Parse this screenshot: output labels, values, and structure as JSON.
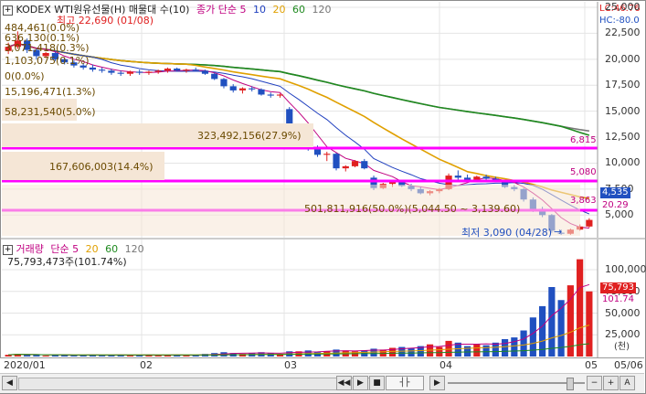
{
  "header": {
    "expand_icon": "plus-box-icon",
    "title": "KODEX WTI원유선물(H)",
    "series_labels": [
      {
        "text": "매물대 수(10)",
        "color": "#222222"
      },
      {
        "text": "종가",
        "color": "#c00080"
      },
      {
        "text": "단순",
        "color": "#c00080"
      },
      {
        "text": "5",
        "color": "#c00080"
      },
      {
        "text": "10",
        "color": "#1f3fbf"
      },
      {
        "text": "20",
        "color": "#e0a000"
      },
      {
        "text": "60",
        "color": "#1f8a1f"
      },
      {
        "text": "120",
        "color": "#777777"
      }
    ],
    "lc": "LC:46.76",
    "hc": "HC:-80.0"
  },
  "annotations": {
    "high": "최고 22,690 (01/08)",
    "low": "최저 3,090 (04/28)",
    "big_profile": "501,811,916(50.0%)(5,044.50 ~ 3,139.60)",
    "percent_tag": "20.29"
  },
  "volume_profile": [
    "484,461(0.0%)",
    "636,130(0.1%)",
    "3,071,418(0.3%)",
    "1,103,075(0.1%)",
    "0(0.0%)",
    "15,196,471(1.3%)",
    "58,231,540(5.0%)",
    "323,492,156(27.9%)",
    "167,606,003(14.4%)"
  ],
  "price_axis": [
    "25,000",
    "22,500",
    "20,000",
    "17,500",
    "15,000",
    "12,500",
    "10,000",
    "7,500",
    "5,000"
  ],
  "price_tags": [
    {
      "text": "6,815",
      "color": "#c00080"
    },
    {
      "text": "5,080",
      "color": "#c00080"
    },
    {
      "text": "4,535",
      "color": "#ffffff",
      "bg": "#2050c0"
    },
    {
      "text": "3,863",
      "color": "#c00080"
    }
  ],
  "volume_header": {
    "labels": [
      {
        "text": "거래량",
        "color": "#c00080"
      },
      {
        "text": "단순",
        "color": "#c00080"
      },
      {
        "text": "5",
        "color": "#c00080"
      },
      {
        "text": "20",
        "color": "#e0a000"
      },
      {
        "text": "60",
        "color": "#1f8a1f"
      },
      {
        "text": "120",
        "color": "#777777"
      }
    ],
    "value": "75,793,473주(101.74%)"
  },
  "volume_axis": [
    "100,000",
    "75,000",
    "50,000",
    "25,000"
  ],
  "volume_tags": [
    {
      "text": "75,793",
      "color": "#ffffff",
      "bg": "#e02020"
    },
    {
      "text": "101.74",
      "color": "#c00080"
    }
  ],
  "volume_unit": "(천)",
  "x_axis": {
    "labels": [
      "2020/01",
      "02",
      "03",
      "04",
      "05"
    ],
    "right_label": "05/06"
  },
  "controls": {
    "left_arrow_icon": "triangle-left-icon",
    "slider_icon": "slider-handle-icon",
    "rewind_icon": "rewind-icon",
    "play_icon": "play-icon",
    "stop_icon": "stop-icon",
    "fast_forward_icon": "fast-forward-icon",
    "minus": "−",
    "plus": "+",
    "text_button": "A"
  },
  "chart_data": {
    "type": "candlestick",
    "y_range": [
      3000,
      25000
    ],
    "volume_range": [
      0,
      120000
    ],
    "colors": {
      "up": "#e02020",
      "down": "#2050c0",
      "ma5": "#c00080",
      "ma10": "#1f3fbf",
      "ma20": "#e0a000",
      "ma60": "#1f8a1f",
      "ma120": "#777777",
      "profile_line": "#ff00ff"
    },
    "candles": [
      [
        20800,
        21600,
        20500,
        21200
      ],
      [
        21200,
        22690,
        21000,
        21800
      ],
      [
        21800,
        22000,
        20600,
        20900
      ],
      [
        20900,
        21000,
        20000,
        20300
      ],
      [
        20300,
        20700,
        20100,
        20600
      ],
      [
        20600,
        20700,
        19800,
        20000
      ],
      [
        20000,
        20200,
        19500,
        19700
      ],
      [
        19700,
        19900,
        19200,
        19400
      ],
      [
        19400,
        19600,
        19000,
        19200
      ],
      [
        19200,
        19500,
        18800,
        19000
      ],
      [
        19000,
        19200,
        18700,
        18900
      ],
      [
        18900,
        19100,
        18500,
        18700
      ],
      [
        18700,
        18900,
        18400,
        18600
      ],
      [
        18600,
        18900,
        18400,
        18800
      ],
      [
        18800,
        19000,
        18500,
        18700
      ],
      [
        18700,
        18900,
        18500,
        18800
      ],
      [
        18800,
        19000,
        18600,
        18900
      ],
      [
        18900,
        19200,
        18700,
        19100
      ],
      [
        19100,
        19200,
        18800,
        18900
      ],
      [
        18900,
        19100,
        18700,
        19000
      ],
      [
        19000,
        19200,
        18800,
        18900
      ],
      [
        18900,
        19000,
        18500,
        18600
      ],
      [
        18600,
        18700,
        18000,
        18100
      ],
      [
        18100,
        18200,
        17200,
        17400
      ],
      [
        17400,
        17600,
        16800,
        17000
      ],
      [
        17000,
        17300,
        16700,
        17200
      ],
      [
        17200,
        17400,
        16900,
        17100
      ],
      [
        17100,
        17200,
        16500,
        16600
      ],
      [
        16600,
        16800,
        16300,
        16500
      ],
      [
        16500,
        16700,
        16300,
        16600
      ],
      [
        15200,
        15400,
        12000,
        12300
      ],
      [
        12300,
        12800,
        11800,
        12500
      ],
      [
        12500,
        12700,
        11200,
        11400
      ],
      [
        11400,
        11700,
        10600,
        10800
      ],
      [
        10800,
        11100,
        10200,
        10900
      ],
      [
        10900,
        11000,
        9300,
        9500
      ],
      [
        9500,
        9800,
        9200,
        9700
      ],
      [
        9700,
        10300,
        9600,
        10200
      ],
      [
        10200,
        10400,
        9400,
        9500
      ],
      [
        8600,
        8800,
        7400,
        7600
      ],
      [
        7600,
        8100,
        7500,
        8000
      ],
      [
        8000,
        8400,
        7700,
        8200
      ],
      [
        8200,
        8300,
        7700,
        7800
      ],
      [
        7800,
        8000,
        7300,
        7500
      ],
      [
        7500,
        7700,
        7000,
        7100
      ],
      [
        7100,
        7400,
        6900,
        7300
      ],
      [
        7300,
        7600,
        7100,
        7500
      ],
      [
        7500,
        9000,
        7400,
        8800
      ],
      [
        8800,
        9300,
        8400,
        8600
      ],
      [
        8600,
        8900,
        8300,
        8400
      ],
      [
        8400,
        8800,
        8200,
        8700
      ],
      [
        8700,
        8900,
        8400,
        8500
      ],
      [
        8500,
        8700,
        8200,
        8300
      ],
      [
        8300,
        8400,
        7600,
        7700
      ],
      [
        7700,
        7900,
        7300,
        7500
      ],
      [
        7500,
        7600,
        6300,
        6500
      ],
      [
        6500,
        6700,
        5300,
        5600
      ],
      [
        5600,
        5800,
        4800,
        5000
      ],
      [
        5000,
        5100,
        3300,
        3500
      ],
      [
        3300,
        3600,
        3090,
        3200
      ],
      [
        3200,
        3700,
        3100,
        3600
      ],
      [
        3600,
        4100,
        3500,
        3900
      ],
      [
        3900,
        4700,
        3800,
        4535
      ]
    ],
    "volume": [
      2,
      3,
      2,
      2,
      1,
      2,
      2,
      1,
      2,
      2,
      1,
      2,
      2,
      1,
      2,
      2,
      1,
      2,
      2,
      1,
      2,
      3,
      4,
      5,
      4,
      3,
      4,
      5,
      4,
      3,
      6,
      6,
      7,
      5,
      6,
      8,
      7,
      6,
      7,
      9,
      8,
      10,
      11,
      10,
      12,
      14,
      11,
      18,
      16,
      12,
      14,
      13,
      16,
      20,
      22,
      30,
      45,
      58,
      80,
      65,
      82,
      112,
      75
    ]
  }
}
